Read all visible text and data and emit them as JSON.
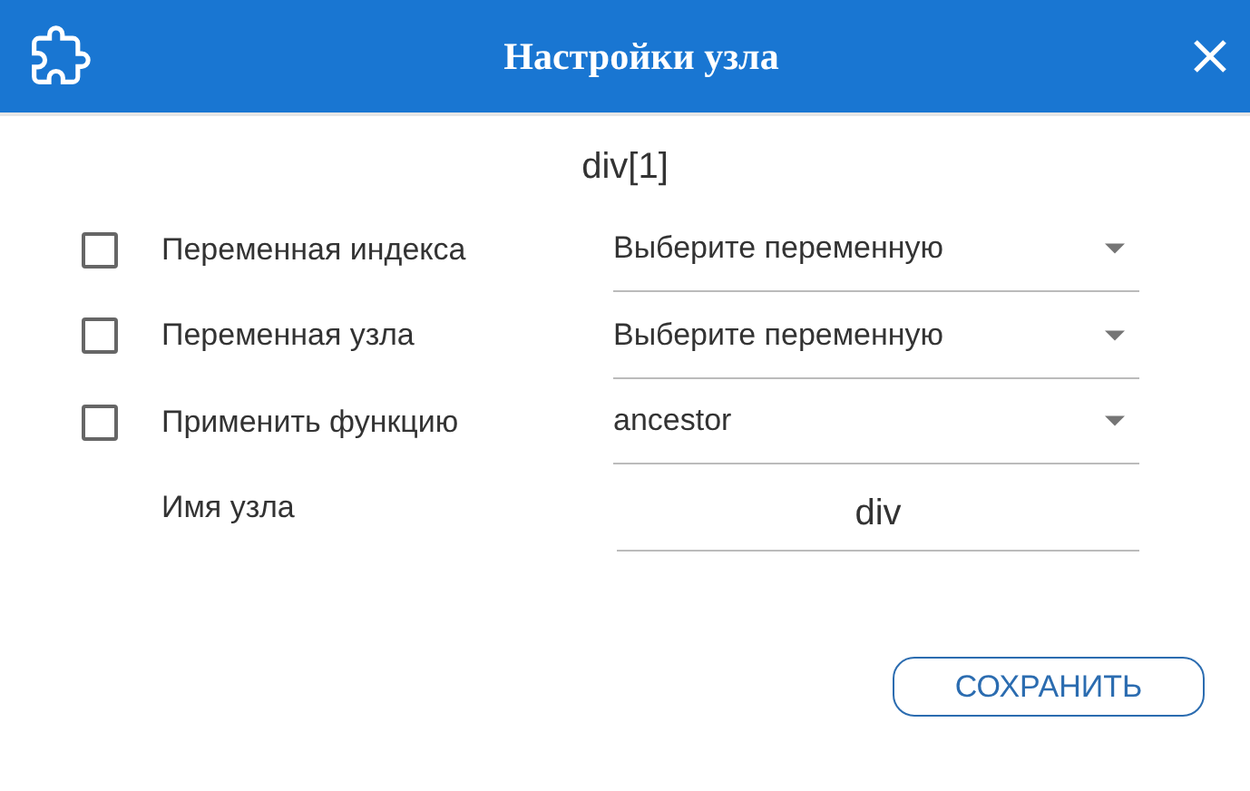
{
  "window": {
    "title": "Настройки узла"
  },
  "heading": "div[1]",
  "rows": [
    {
      "kind": "select",
      "checked": false,
      "label": "Переменная индекса",
      "value": "Выберите переменную"
    },
    {
      "kind": "select",
      "checked": false,
      "label": "Переменная узла",
      "value": "Выберите переменную"
    },
    {
      "kind": "select",
      "checked": false,
      "label": "Применить функцию",
      "value": "ancestor"
    },
    {
      "kind": "text",
      "label": "Имя узла",
      "value": "div"
    }
  ],
  "buttons": [
    "СОХРАНИТЬ"
  ]
}
